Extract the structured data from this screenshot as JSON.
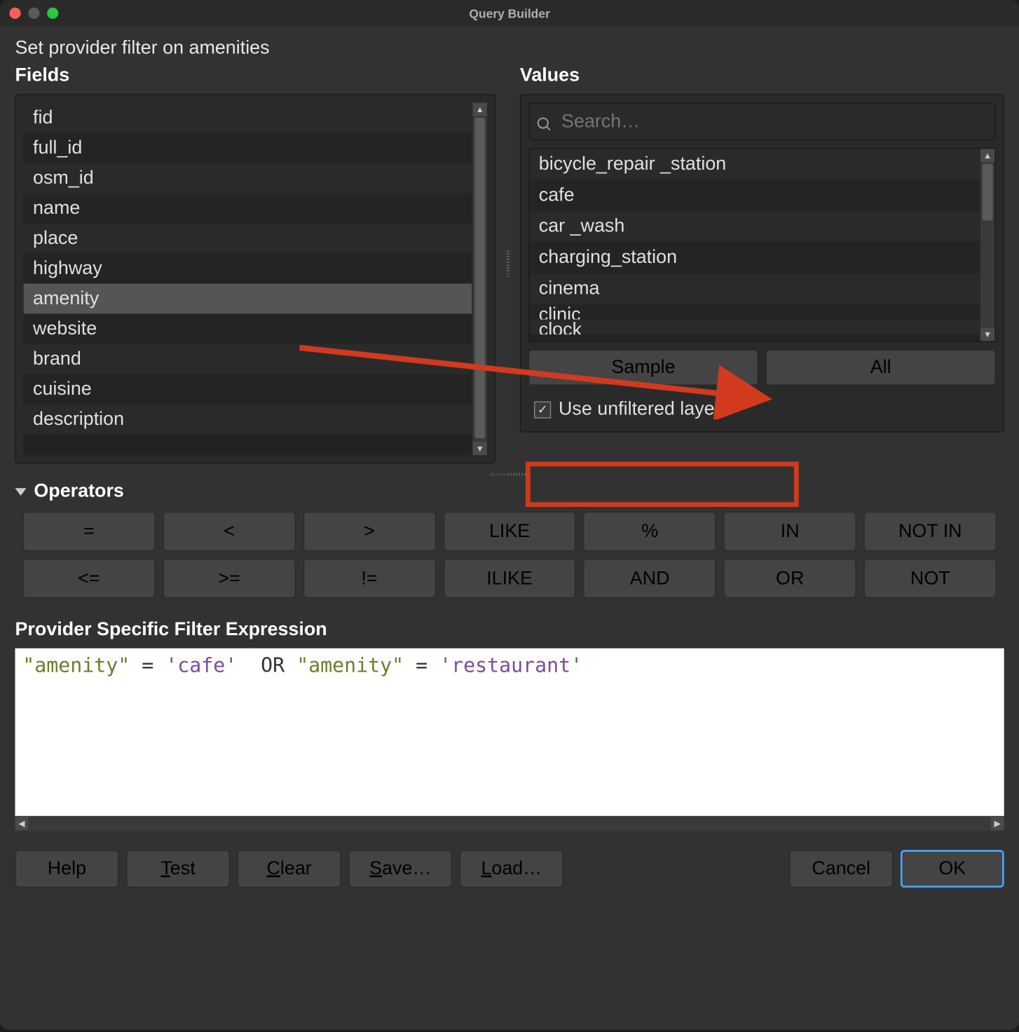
{
  "window_title": "Query Builder",
  "subtitle": "Set provider filter on amenities",
  "fields": {
    "heading": "Fields",
    "items": [
      "fid",
      "full_id",
      "osm_id",
      "name",
      "place",
      "highway",
      "amenity",
      "website",
      "brand",
      "cuisine",
      "description"
    ],
    "selected_index": 6
  },
  "values": {
    "heading": "Values",
    "search_placeholder": "Search…",
    "items": [
      "bicycle_repair_station",
      "cafe",
      "car_wash",
      "charging_station",
      "cinema",
      "clinic",
      "clock"
    ],
    "sample_label": "Sample",
    "all_label": "All",
    "use_unfiltered_label": "Use unfiltered layer",
    "use_unfiltered_checked": true
  },
  "operators": {
    "heading": "Operators",
    "row1": [
      "=",
      "<",
      ">",
      "LIKE",
      "%",
      "IN",
      "NOT IN"
    ],
    "row2": [
      "<=",
      ">=",
      "!=",
      "ILIKE",
      "AND",
      "OR",
      "NOT"
    ]
  },
  "expression": {
    "heading": "Provider Specific Filter Expression",
    "tokens": [
      {
        "t": "field",
        "v": "\"amenity\""
      },
      {
        "t": "sp",
        "v": " "
      },
      {
        "t": "op",
        "v": "="
      },
      {
        "t": "sp",
        "v": " "
      },
      {
        "t": "str",
        "v": "'cafe'"
      },
      {
        "t": "sp",
        "v": "  "
      },
      {
        "t": "kw",
        "v": "OR"
      },
      {
        "t": "sp",
        "v": " "
      },
      {
        "t": "field",
        "v": "\"amenity\""
      },
      {
        "t": "sp",
        "v": " "
      },
      {
        "t": "op",
        "v": "="
      },
      {
        "t": "sp",
        "v": " "
      },
      {
        "t": "str",
        "v": "'restaurant'"
      }
    ]
  },
  "buttons": {
    "help": "Help",
    "test": "Test",
    "clear": "Clear",
    "save": "Save…",
    "load": "Load…",
    "cancel": "Cancel",
    "ok": "OK"
  }
}
